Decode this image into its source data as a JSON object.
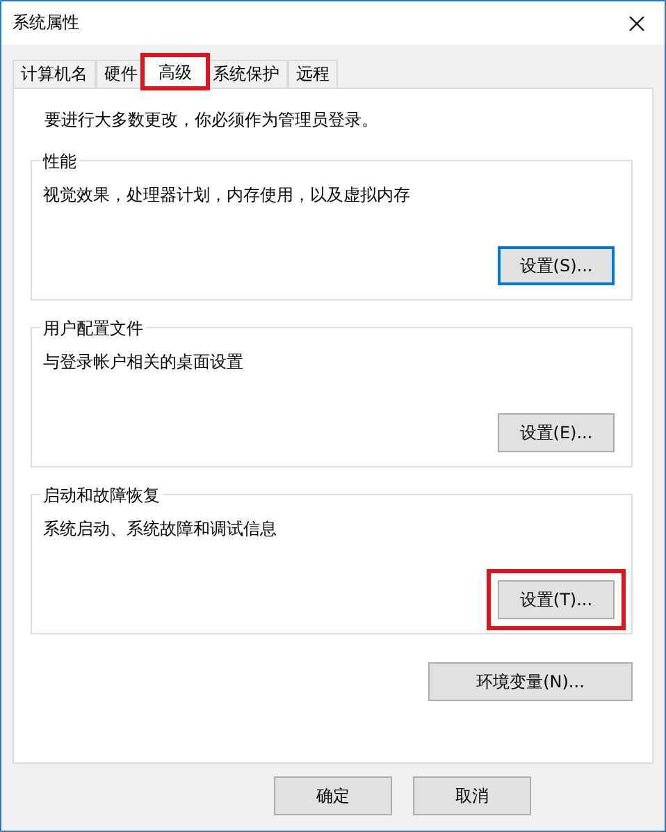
{
  "window": {
    "title": "系统属性"
  },
  "tabs": [
    {
      "label": "计算机名",
      "selected": false,
      "highlighted": false
    },
    {
      "label": "硬件",
      "selected": false,
      "highlighted": false
    },
    {
      "label": "高级",
      "selected": true,
      "highlighted": true
    },
    {
      "label": "系统保护",
      "selected": false,
      "highlighted": false
    },
    {
      "label": "远程",
      "selected": false,
      "highlighted": false
    }
  ],
  "notice": "要进行大多数更改，你必须作为管理员登录。",
  "groups": [
    {
      "title": "性能",
      "description": "视觉效果，处理器计划，内存使用，以及虚拟内存",
      "button": "设置(S)...",
      "focused": true,
      "highlighted": false
    },
    {
      "title": "用户配置文件",
      "description": "与登录帐户相关的桌面设置",
      "button": "设置(E)...",
      "focused": false,
      "highlighted": false
    },
    {
      "title": "启动和故障恢复",
      "description": "系统启动、系统故障和调试信息",
      "button": "设置(T)...",
      "focused": false,
      "highlighted": true
    }
  ],
  "environment_button": "环境变量(N)...",
  "buttons": [
    "确定",
    "取消"
  ]
}
